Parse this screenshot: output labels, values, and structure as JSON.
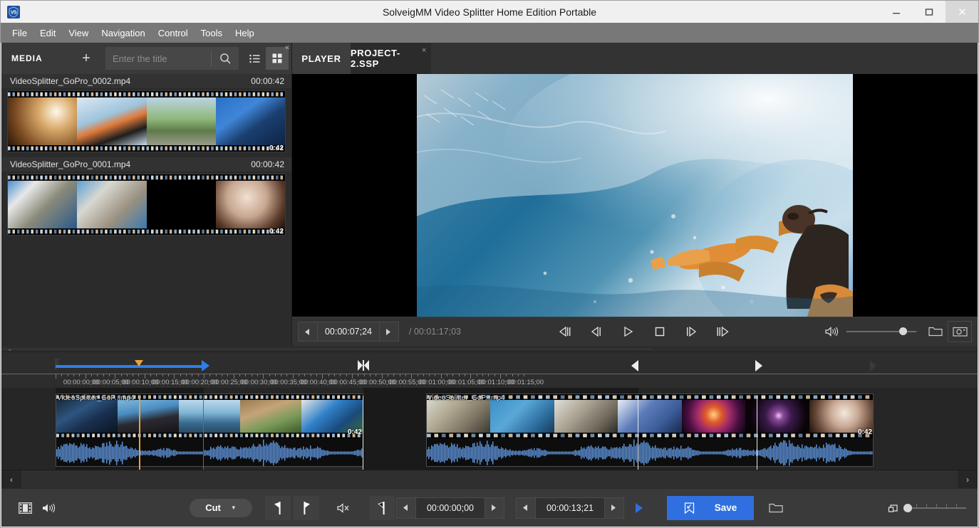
{
  "window": {
    "title": "SolveigMM Video Splitter Home Edition Portable",
    "logo_text": "VS",
    "minimize": "–",
    "maximize": "□",
    "close": "✕"
  },
  "menubar": {
    "items": [
      "File",
      "Edit",
      "View",
      "Navigation",
      "Control",
      "Tools",
      "Help"
    ]
  },
  "media_panel": {
    "title": "MEDIA",
    "add_label": "+",
    "search_placeholder": "Enter the title",
    "search_value": "",
    "search_icon": "search-icon",
    "list_view_icon": "list-view-icon",
    "grid_view_icon": "grid-view-icon",
    "collapse_icon": "collapse-panel-icon",
    "items": [
      {
        "name": "VideoSplitter_GoPro_0002.mp4",
        "duration": "00:00:42",
        "thumb_duration": "0:42"
      },
      {
        "name": "VideoSplitter_GoPro_0001.mp4",
        "duration": "00:00:42",
        "thumb_duration": "0:42"
      }
    ]
  },
  "tabs": [
    {
      "label": "PLAYER",
      "active": false,
      "closable": false
    },
    {
      "label": "PROJECT-2.SSP",
      "active": true,
      "closable": true,
      "close_label": "×"
    }
  ],
  "player": {
    "current_time": "00:00:07;24",
    "total_time_sep": "/",
    "total_time": "00:01:17;03",
    "prev_frame_label": "◀",
    "next_frame_label": "▶",
    "buttons": [
      {
        "name": "step-back-button",
        "icon": "step-back-icon"
      },
      {
        "name": "prev-frame-button",
        "icon": "prev-frame-icon"
      },
      {
        "name": "play-button",
        "icon": "play-icon"
      },
      {
        "name": "stop-button",
        "icon": "stop-icon"
      },
      {
        "name": "next-frame-button",
        "icon": "next-frame-icon"
      },
      {
        "name": "step-forward-button",
        "icon": "step-forward-icon"
      }
    ],
    "volume_icon": "volume-icon",
    "volume_percent": 76,
    "open_folder_icon": "folder-icon",
    "snapshot_icon": "camera-icon"
  },
  "timeline": {
    "ruler_labels": [
      "00:00:00;00",
      "00:00:05;00",
      "00:00:10;00",
      "00:00:15;00",
      "00:00:20;00",
      "00:00:25;00",
      "00:00:30;00",
      "00:00:35;00",
      "00:00:40;00",
      "00:00:45;00",
      "00:00:50;00",
      "00:00:55;00",
      "00:01:00;00",
      "00:01:05;00",
      "00:01:10;00",
      "00:01:15;00"
    ],
    "clip_labels": [
      "VideoSplitter_GoP...mp4",
      "VideoSplitter_GoP...mp4"
    ],
    "clip_durations": [
      "0:42",
      "0:42"
    ],
    "scroll_left_icon": "scroll-left-icon",
    "scroll_right_icon": "scroll-right-icon"
  },
  "bottom_toolbar": {
    "video_track_icon": "film-icon",
    "audio_track_icon": "speaker-icon",
    "edit_mode": "Cut",
    "edit_mode_caret": "▼",
    "mark_in_icon": "mark-in-icon",
    "mark_out_icon": "mark-out-icon",
    "mute_icon": "mute-icon",
    "marker_icon": "marker-icon",
    "start_time": "00:00:00;00",
    "end_time": "00:00:13;21",
    "play_selection_icon": "play-selection-icon",
    "save_label": "Save",
    "save_icon": "save-arrow-icon",
    "open_icon": "open-folder-icon",
    "zoom_icon": "fit-zoom-icon",
    "zoom_value": 0
  },
  "colors": {
    "accent_blue": "#2f7fe8",
    "save_blue": "#2f6fe0",
    "playhead_orange": "#e8a33d",
    "titlebar_bg": "#f0f0f0",
    "menubar_bg": "#787878",
    "panel_bg": "#2b2b2b"
  }
}
